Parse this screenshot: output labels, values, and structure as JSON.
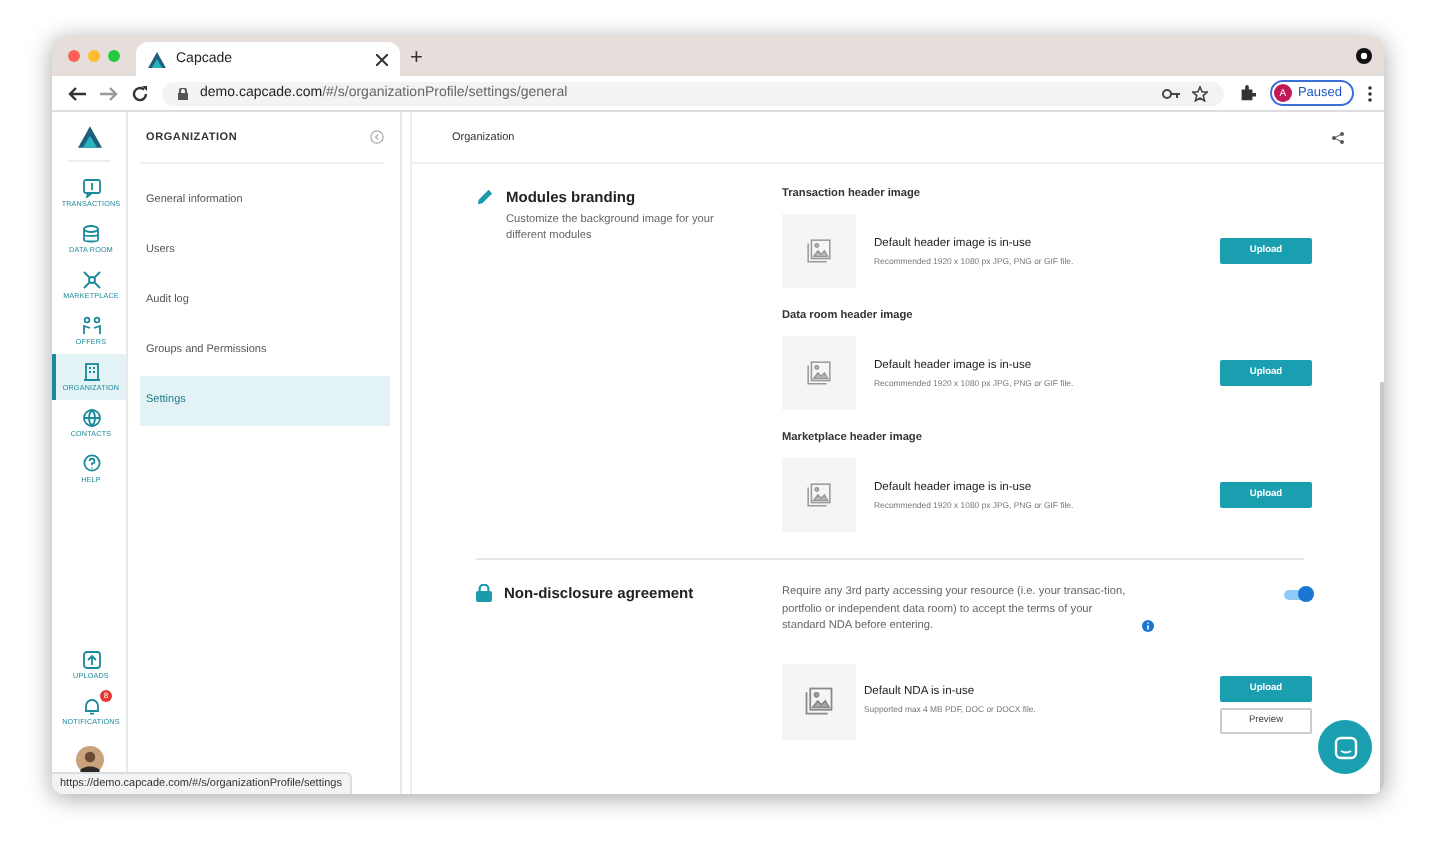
{
  "browser": {
    "tab_title": "Capcade",
    "new_tab": "+",
    "url_host": "demo.capcade.com",
    "url_path": "/#/s/organizationProfile/settings/general",
    "profile_letter": "A",
    "profile_label": "Paused",
    "status_url": "https://demo.capcade.com/#/s/organizationProfile/settings"
  },
  "rail": {
    "items": [
      {
        "label": "TRANSACTIONS",
        "selected": false
      },
      {
        "label": "DATA ROOM",
        "selected": false
      },
      {
        "label": "MARKETPLACE",
        "selected": false
      },
      {
        "label": "OFFERS",
        "selected": false
      },
      {
        "label": "ORGANIZATION",
        "selected": true
      },
      {
        "label": "CONTACTS",
        "selected": false
      },
      {
        "label": "HELP",
        "selected": false
      }
    ],
    "bottom_items": [
      {
        "label": "UPLOADS"
      },
      {
        "label": "NOTIFICATIONS",
        "badge": "8"
      }
    ]
  },
  "sidebar": {
    "title": "ORGANIZATION",
    "items": [
      {
        "label": "General information",
        "selected": false
      },
      {
        "label": "Users",
        "selected": false
      },
      {
        "label": "Audit log",
        "selected": false
      },
      {
        "label": "Groups and Permissions",
        "selected": false
      },
      {
        "label": "Settings",
        "selected": true
      }
    ]
  },
  "main": {
    "title": "Organization",
    "branding": {
      "title": "Modules branding",
      "description": "Customize the background image for your different modules",
      "images": [
        {
          "label": "Transaction header image",
          "status": "Default header image is in-use",
          "note": "Recommended 1920 x 1080 px JPG, PNG or GIF file.",
          "button": "Upload"
        },
        {
          "label": "Data room header image",
          "status": "Default header image is in-use",
          "note": "Recommended 1920 x 1080 px JPG, PNG or GIF file.",
          "button": "Upload"
        },
        {
          "label": "Marketplace header image",
          "status": "Default header image is in-use",
          "note": "Recommended 1920 x 1080 px JPG, PNG or GIF file.",
          "button": "Upload"
        }
      ]
    },
    "nda": {
      "title": "Non-disclosure agreement",
      "description": "Require any 3rd party accessing your resource (i.e. your transac-tion, portfolio or independent data room) to accept the terms of your standard NDA before entering.",
      "on": true,
      "status": "Default NDA is in-use",
      "note": "Supported max 4 MB PDF, DOC or DOCX file.",
      "upload_button": "Upload",
      "preview_button": "Preview"
    }
  }
}
